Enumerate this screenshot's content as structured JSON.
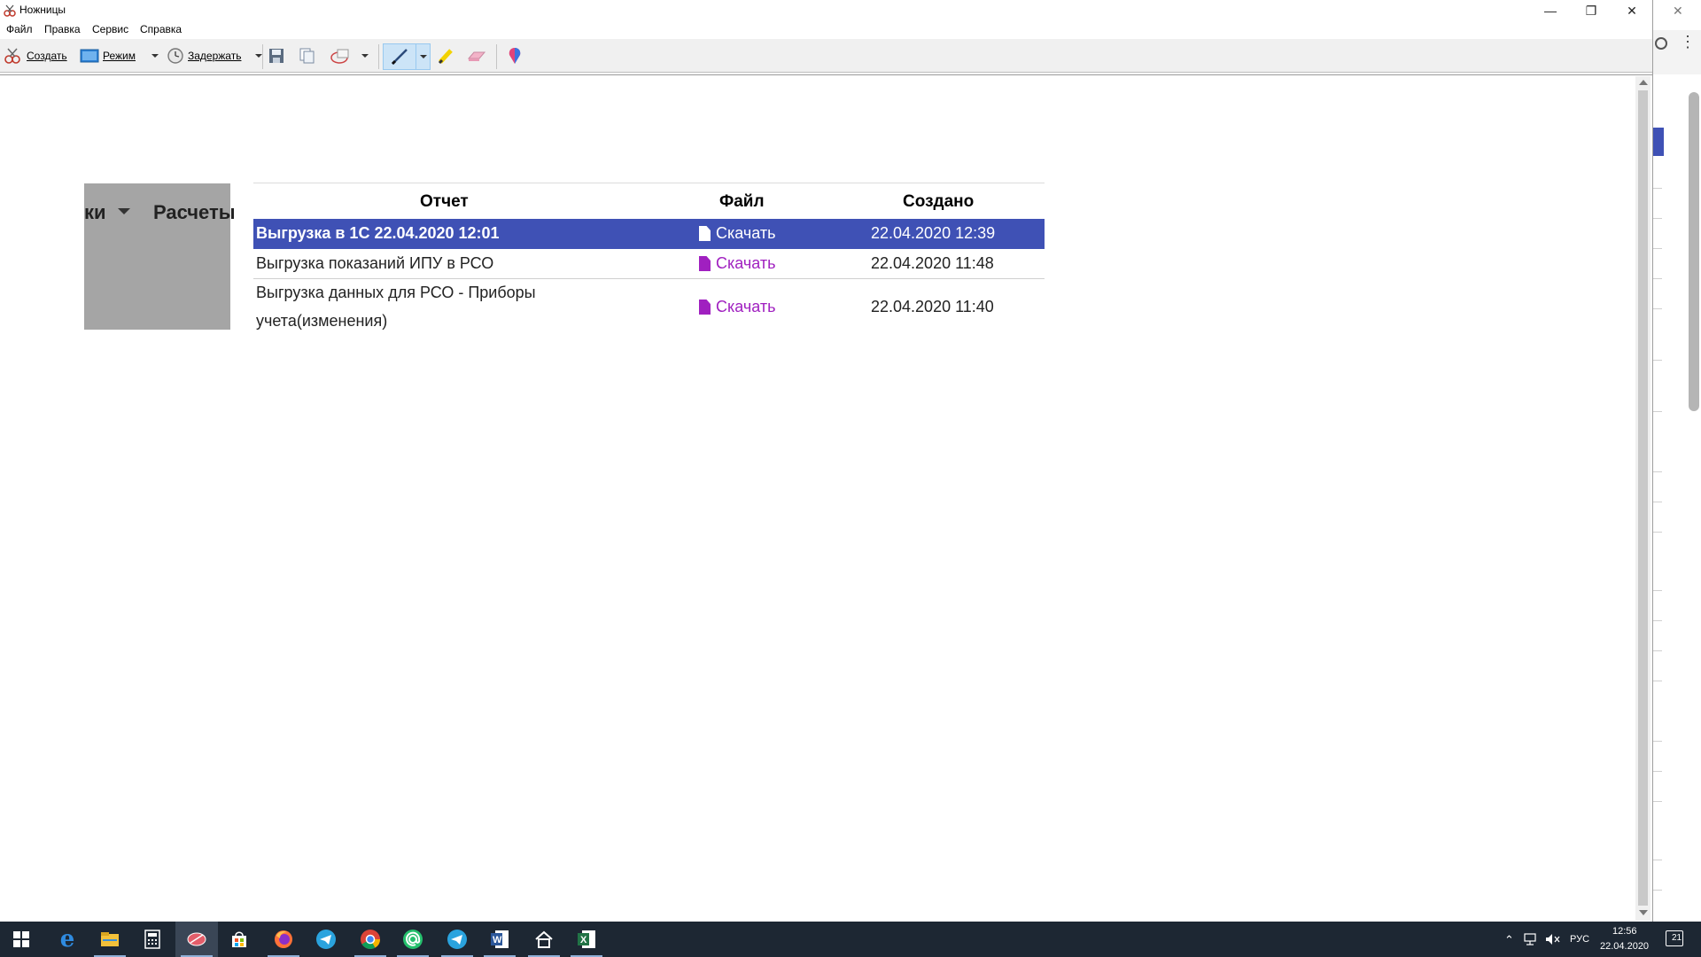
{
  "window": {
    "title": "Ножницы",
    "minimize_glyph": "—",
    "restore_glyph": "❐",
    "close_glyph": "✕"
  },
  "menu": [
    "Файл",
    "Правка",
    "Сервис",
    "Справка"
  ],
  "toolbar": {
    "create_label": "Создать",
    "mode_label": "Режим",
    "delay_label": "Задержать"
  },
  "content": {
    "tab_fragment": "ки",
    "tab_title": "Расчеты",
    "table": {
      "headers": [
        "Отчет",
        "Файл",
        "Создано"
      ],
      "rows": [
        {
          "report": "Выгрузка в 1С 22.04.2020 12:01",
          "file": "Скачать",
          "created": "22.04.2020 12:39",
          "selected": true
        },
        {
          "report": "Выгрузка показаний ИПУ в РСО",
          "file": "Скачать",
          "created": "22.04.2020 11:48",
          "selected": false
        },
        {
          "report_line1": "Выгрузка данных для РСО - Приборы",
          "report_line2": "учета(изменения)",
          "file": "Скачать",
          "created": "22.04.2020 11:40",
          "selected": false
        }
      ]
    }
  },
  "browser_strip": {
    "close_glyph": "✕",
    "accent_color": "#3f51b5"
  },
  "taskbar": {
    "apps": [
      "start-icon",
      "edge-icon",
      "file-explorer-icon",
      "calculator-icon",
      "snipping-tool-icon",
      "store-icon",
      "firefox-icon",
      "telegram-icon",
      "chrome-icon",
      "mail-at-icon",
      "telegram-icon",
      "word-icon",
      "home-icon",
      "excel-icon"
    ],
    "language": "РУС",
    "time": "12:56",
    "date": "22.04.2020",
    "notifications": "21"
  },
  "colors": {
    "selection": "#3f51b5",
    "link": "#a020c0",
    "taskbar": "#1d2733"
  }
}
